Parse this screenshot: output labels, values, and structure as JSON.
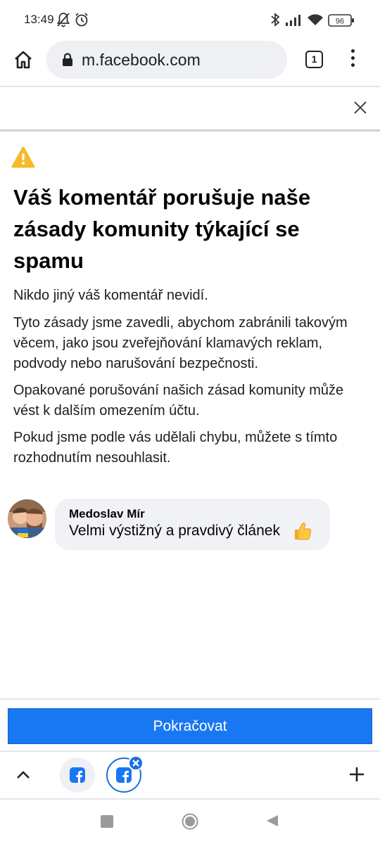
{
  "status_bar": {
    "time": "13:49",
    "battery": "96",
    "icons": [
      "mute-bell-icon",
      "alarm-icon",
      "bluetooth-icon",
      "signal-icon",
      "wifi-icon",
      "battery-icon"
    ]
  },
  "browser": {
    "url": "m.facebook.com",
    "tab_count": "1",
    "icons": [
      "home-icon",
      "lock-icon",
      "tab-switcher-icon",
      "more-menu-icon"
    ]
  },
  "notice": {
    "title": "Váš komentář porušuje naše zásady komunity týkající se spamu",
    "paragraphs": [
      "Nikdo jiný váš komentář nevidí.",
      "Tyto zásady jsme zavedli, abychom zabránili takovým věcem, jako jsou zveřejňování klamavých reklam, podvody nebo narušování bezpečnosti.",
      "Opakované porušování našich zásad komunity může vést k dalším omezením účtu.",
      "Pokud jsme podle vás udělali chybu, můžete s tímto rozhodnutím nesouhlasit."
    ]
  },
  "comment": {
    "author": "Medoslav Mír",
    "text": "Velmi výstižný a pravdivý článek",
    "emoji": "thumbs-up-icon"
  },
  "actions": {
    "continue_label": "Pokračovat"
  },
  "colors": {
    "primary": "#1877f2",
    "warning": "#f7b928",
    "bubble": "#f0f2f5",
    "tab_active": "#1a6fd8"
  }
}
